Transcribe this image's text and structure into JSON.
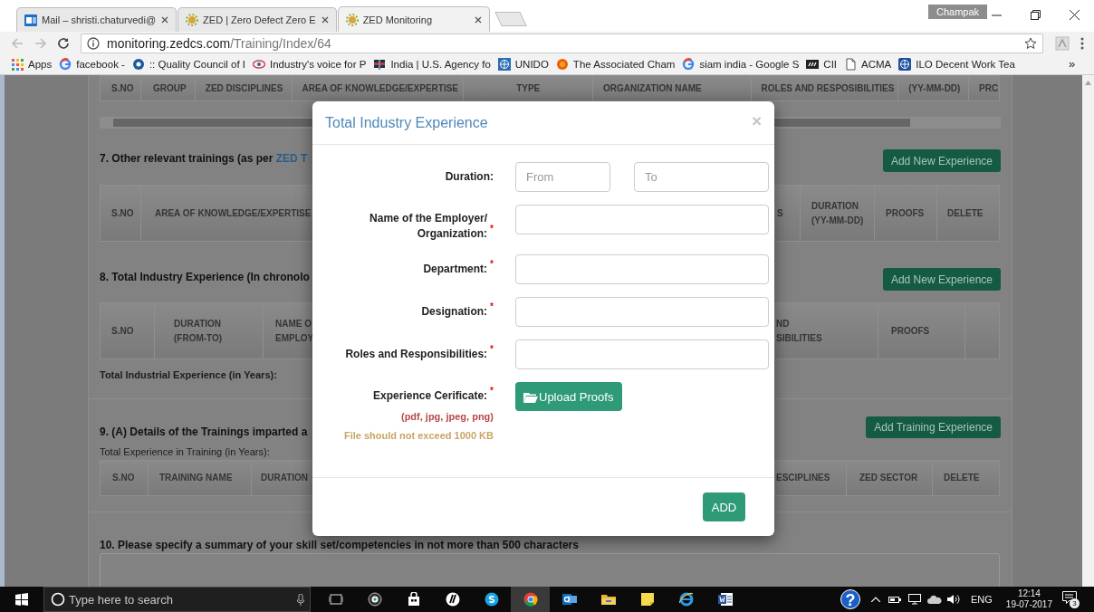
{
  "browser": {
    "tabs": [
      {
        "title": "Mail – shristi.chaturvedi@",
        "selected": false
      },
      {
        "title": "ZED | Zero Defect Zero E",
        "selected": false
      },
      {
        "title": "ZED Monitoring",
        "selected": true
      }
    ],
    "profile": "Champak",
    "url": {
      "host": "monitoring.zedcs.com",
      "path": "/Training/Index/64"
    },
    "bookmarks": [
      {
        "label": "Apps"
      },
      {
        "label": "facebook -"
      },
      {
        "label": ":: Quality Council of I"
      },
      {
        "label": "Industry's voice for P"
      },
      {
        "label": "India | U.S. Agency fo"
      },
      {
        "label": "UNIDO"
      },
      {
        "label": "The Associated Cham"
      },
      {
        "label": "siam india - Google S"
      },
      {
        "label": "CII"
      },
      {
        "label": "ACMA"
      },
      {
        "label": "ILO Decent Work Tea"
      }
    ],
    "bookmarks_more": "»"
  },
  "page": {
    "table_top": {
      "columns": [
        "S.NO",
        "GROUP",
        "ZED DISCIPLINES",
        "AREA OF KNOWLEDGE/EXPERTISE",
        "TYPE",
        "ORGANIZATION NAME",
        "ROLES AND RESPOSIBILITIES",
        "(YY-MM-DD)",
        "PRC"
      ]
    },
    "sections": [
      {
        "heading": "7. Other relevant trainings (as per ",
        "link": "ZED T",
        "button": "Add New Experience",
        "columns_left": [
          "S.NO",
          "AREA OF KNOWLEDGE/EXPERTISE"
        ],
        "columns_right": [
          "S",
          "DURATION\n(YY-MM-DD)",
          "PROOFS",
          "DELETE"
        ]
      },
      {
        "heading": "8. Total Industry Experience (In chronolo",
        "button": "Add New Experience",
        "columns_left": [
          "S.NO",
          "DURATION\n(FROM-TO)",
          "NAME O\nEMPLOY"
        ],
        "columns_right": [
          "ND\nSIBILITIES",
          "PROOFS"
        ],
        "total_label": "Total Industrial Experience (in Years):"
      },
      {
        "heading": "9. (A) Details of the Trainings imparted a",
        "button": "Add Training Experience",
        "subheading": "Total Experience in Training (in Years):",
        "columns_left": [
          "S.NO",
          "TRAINING NAME",
          "DURATION"
        ],
        "columns_right": [
          "ESCIPLINES",
          "ZED SECTOR",
          "DELETE"
        ]
      }
    ],
    "summary_heading": "10. Please specify a summary of your skill set/competencies in not more than 500 characters"
  },
  "modal": {
    "title": "Total Industry Experience",
    "close": "×",
    "fields": [
      {
        "kind": "range",
        "label": "Duration:",
        "inputs": [
          {
            "placeholder": "From"
          },
          {
            "placeholder": "To"
          }
        ]
      },
      {
        "kind": "text",
        "label": "Name of the Employer/ Organization:",
        "required_mark": "*"
      },
      {
        "kind": "text",
        "label": "Department:",
        "required_mark": "*"
      },
      {
        "kind": "text",
        "label": "Designation:",
        "required_mark": "*"
      },
      {
        "kind": "text",
        "label": "Roles and Responsibilities:",
        "required_mark": "*"
      },
      {
        "kind": "upload",
        "label": "Experience Cerificate:",
        "required_mark": "*",
        "formats": "(pdf, jpg, jpeg, png)",
        "size_note": "File should not exceed 1000 KB",
        "button": "Upload Proofs"
      }
    ],
    "submit": "ADD"
  },
  "taskbar": {
    "search": {
      "placeholder": "Type here to search"
    },
    "apps": [
      {
        "selected": false
      },
      {
        "selected": false
      },
      {
        "selected": false
      },
      {
        "selected": false
      },
      {
        "selected": false
      },
      {
        "selected": true
      },
      {
        "selected": false
      },
      {
        "selected": false
      },
      {
        "selected": false
      },
      {
        "selected": false
      },
      {
        "selected": false
      }
    ],
    "help": "?",
    "language": "ENG",
    "time": "12:14",
    "date": "19-07-2017",
    "notifications": "3"
  }
}
